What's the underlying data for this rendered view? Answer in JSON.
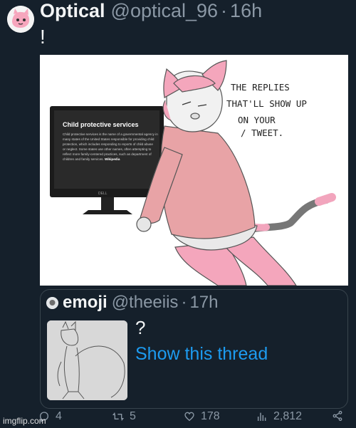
{
  "tweet": {
    "display_name": "Optical",
    "handle": "@optical_96",
    "separator": "·",
    "time": "16h",
    "text": "!"
  },
  "media": {
    "monitor_card_title": "Child protective services",
    "monitor_card_body": "Child protective services is the name of a governmental agency in many states of the United States responsible for providing child protection, which includes responding to reports of child abuse or neglect. Some states use other names, often attempting to reflect more family-centered practices, such as department of children and family services.",
    "monitor_card_source": "Wikipedia",
    "monitor_brand": "DELL",
    "speech_lines": [
      "THE REPLIES",
      "THAT'LL SHOW UP",
      "ON YOUR",
      "/ TWEET."
    ]
  },
  "quote": {
    "display_name": "emoji",
    "handle": "@theeiis",
    "separator": "·",
    "time": "17h",
    "text": "?",
    "link": "Show this thread"
  },
  "actions": {
    "replies": "4",
    "retweets": "5",
    "likes": "178",
    "views": "2,812"
  },
  "watermark": "imgflip.com",
  "colors": {
    "background": "#15202b",
    "link": "#1d9bf0",
    "muted": "#8b98a5"
  }
}
